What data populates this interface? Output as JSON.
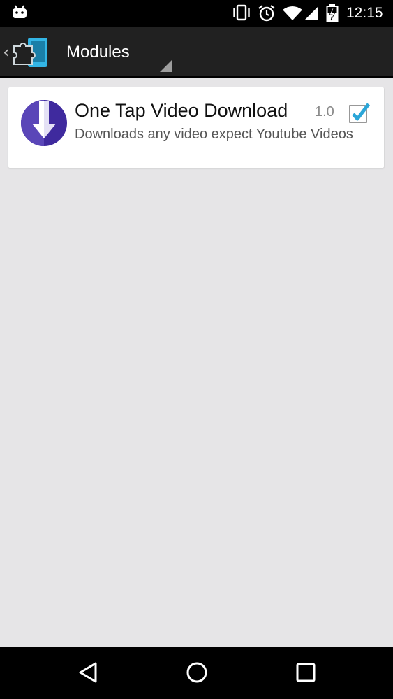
{
  "status_bar": {
    "time": "12:15",
    "icons": [
      "android-notification-icon",
      "vibrate-icon",
      "alarm-icon",
      "wifi-icon",
      "signal-icon",
      "battery-charging-icon"
    ]
  },
  "action_bar": {
    "title": "Modules",
    "app_icon": "xposed-puzzle-icon",
    "colors": {
      "background": "#212121",
      "accent": "#33b5e5"
    }
  },
  "modules": [
    {
      "name": "One Tap Video Download",
      "version": "1.0",
      "description": "Downloads any video expect Youtube Videos",
      "enabled": true,
      "icon": "download-arrow-icon",
      "icon_color": "#3f2a9e"
    }
  ],
  "nav_bar": {
    "buttons": [
      "back-icon",
      "home-icon",
      "recents-icon"
    ]
  }
}
